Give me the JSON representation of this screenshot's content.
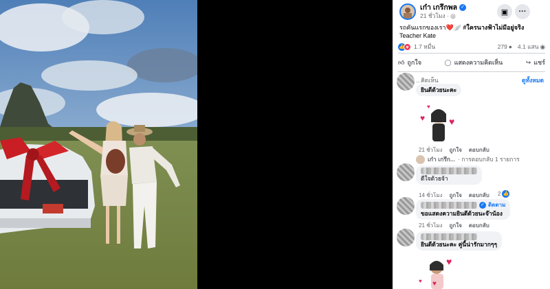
{
  "post": {
    "author": "เก๋า เกรึกพล",
    "time": "21 ชั่วโมง ·",
    "caption": "รถคันแรกของเรา",
    "hashtag": "#ใครนางฟ้าไม่มีอยู่จริง",
    "caption_line2": "Teacher Kate",
    "reactions": "1.7 หมื่น",
    "comments_count": "279",
    "views": "4.1 แสน"
  },
  "actions": {
    "like": "ถูกใจ",
    "comment": "แสดงความคิดเห็น",
    "share": "แชร์"
  },
  "comments_header": {
    "sort": "...คิดเห็น",
    "view_all": "ดูทั้งหมด"
  },
  "comments": [
    {
      "text": "ยินดีด้วยนะคะ",
      "time": "21 ชั่วโมง",
      "like": "ถูกใจ",
      "reply": "ตอบกลับ"
    },
    {
      "text": "ดีใจด้วยจ้า",
      "time": "14 ชั่วโมง",
      "like": "ถูกใจ",
      "reply": "ตอบกลับ",
      "likes": "2"
    },
    {
      "text": "ขอแสดงความยินดีด้วยนะจ๊าน้อง",
      "follow": "ติดตาม",
      "time": "21 ชั่วโมง",
      "like": "ถูกใจ",
      "reply": "ตอบกลับ"
    },
    {
      "text": "ยินดีด้วยนะคะ คู่นี้น่ารักมากๆๆ"
    }
  ],
  "reply_summary": {
    "author": "เก๋า เกรึก...",
    "text": "· การตอบกลับ 1 รายการ"
  },
  "colors": {
    "accent": "#1877f2",
    "love": "#f33e58",
    "bubble": "#f0f2f5"
  },
  "icons": [
    "verified-icon",
    "bookmark-icon",
    "more-icon",
    "like-icon",
    "comment-icon",
    "share-icon",
    "globe-icon",
    "eye-icon",
    "comment-bubble-icon"
  ]
}
